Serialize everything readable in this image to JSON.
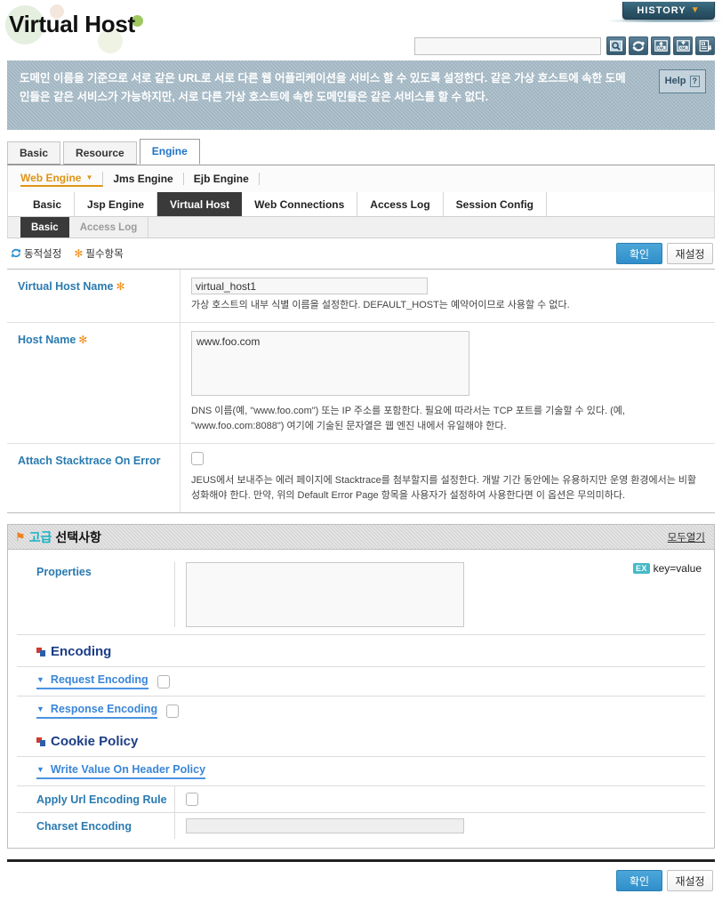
{
  "header": {
    "title": "Virtual Host",
    "history_label": "HISTORY",
    "history_caret": "▼",
    "search_placeholder": ""
  },
  "toolbar": {
    "icons": [
      {
        "name": "search-icon",
        "label": "Search"
      },
      {
        "name": "refresh-icon",
        "label": "Refresh"
      },
      {
        "name": "xml-upload-icon",
        "label": "XML Upload"
      },
      {
        "name": "xml-download-icon",
        "label": "XML Download"
      },
      {
        "name": "report-export-icon",
        "label": "Report Export"
      }
    ]
  },
  "description": {
    "text": "도메인 이름을 기준으로 서로 같은 URL로 서로 다른 웹 어플리케이션을 서비스 할 수 있도록 설정한다. 같은 가상 호스트에 속한 도메인들은 같은 서비스가 가능하지만, 서로 다른 가상 호스트에 속한 도메인들은 같은 서비스를 할 수 없다.",
    "help_label": "Help",
    "help_glyph": "?"
  },
  "tabs_level1": [
    {
      "label": "Basic",
      "active": false
    },
    {
      "label": "Resource",
      "active": false
    },
    {
      "label": "Engine",
      "active": true
    }
  ],
  "engine_row": [
    {
      "label": "Web Engine",
      "active": true,
      "caret": "▼"
    },
    {
      "label": "Jms Engine",
      "active": false
    },
    {
      "label": "Ejb Engine",
      "active": false
    }
  ],
  "tabs_level2": [
    {
      "label": "Basic",
      "active": false
    },
    {
      "label": "Jsp Engine",
      "active": false
    },
    {
      "label": "Virtual Host",
      "active": true
    },
    {
      "label": "Web Connections",
      "active": false
    },
    {
      "label": "Access Log",
      "active": false
    },
    {
      "label": "Session Config",
      "active": false
    }
  ],
  "tabs_level3": [
    {
      "label": "Basic",
      "active": true
    },
    {
      "label": "Access Log",
      "active": false
    }
  ],
  "actionbar": {
    "dynamic_label": "동적설정",
    "required_label": "필수항목",
    "required_glyph": "✻",
    "confirm_label": "확인",
    "reset_label": "재설정"
  },
  "form": {
    "rows": [
      {
        "label": "Virtual Host Name",
        "required": true,
        "type": "text",
        "value": "virtual_host1",
        "hint": "가상 호스트의 내부 식별 이름을 설정한다. DEFAULT_HOST는 예약어이므로 사용할 수 없다."
      },
      {
        "label": "Host Name",
        "required": true,
        "type": "textarea",
        "value": "www.foo.com",
        "hint": "DNS 이름(예, \"www.foo.com\") 또는 IP 주소를 포함한다. 필요에 따라서는 TCP 포트를 기술할 수 있다. (예, \"www.foo.com:8088\") 여기에 기술된 문자열은 웹 엔진 내에서 유일해야 한다."
      },
      {
        "label": "Attach Stacktrace On Error",
        "required": false,
        "type": "checkbox",
        "checked": false,
        "hint": "JEUS에서 보내주는 에러 페이지에 Stacktrace를 첨부할지를 설정한다. 개발 기간 동안에는 유용하지만 운영 환경에서는 비활성화해야 한다. 만약, 위의 Default Error Page 항목을 사용자가 설정하여 사용한다면 이 옵션은 무의미하다."
      }
    ]
  },
  "advanced": {
    "pin_glyph": "⚑",
    "title_keyword": "고급",
    "title_rest": "선택사항",
    "open_all_label": "모두열기",
    "properties": {
      "label": "Properties",
      "value": "",
      "ex_chip": "EX",
      "ex_text": "key=value"
    },
    "groups": [
      {
        "title": "Encoding",
        "items": [
          {
            "label": "Request Encoding",
            "type": "expand-checkbox",
            "checked": false,
            "caret": "▼"
          },
          {
            "label": "Response Encoding",
            "type": "expand-checkbox",
            "checked": false,
            "caret": "▼"
          }
        ]
      },
      {
        "title": "Cookie Policy",
        "items": [
          {
            "label": "Write Value On Header Policy",
            "type": "expand",
            "caret": "▼"
          },
          {
            "label": "Apply Url Encoding Rule",
            "type": "checkbox",
            "checked": false
          },
          {
            "label": "Charset Encoding",
            "type": "text",
            "value": ""
          }
        ]
      }
    ]
  },
  "footer": {
    "confirm_label": "확인",
    "reset_label": "재설정"
  }
}
